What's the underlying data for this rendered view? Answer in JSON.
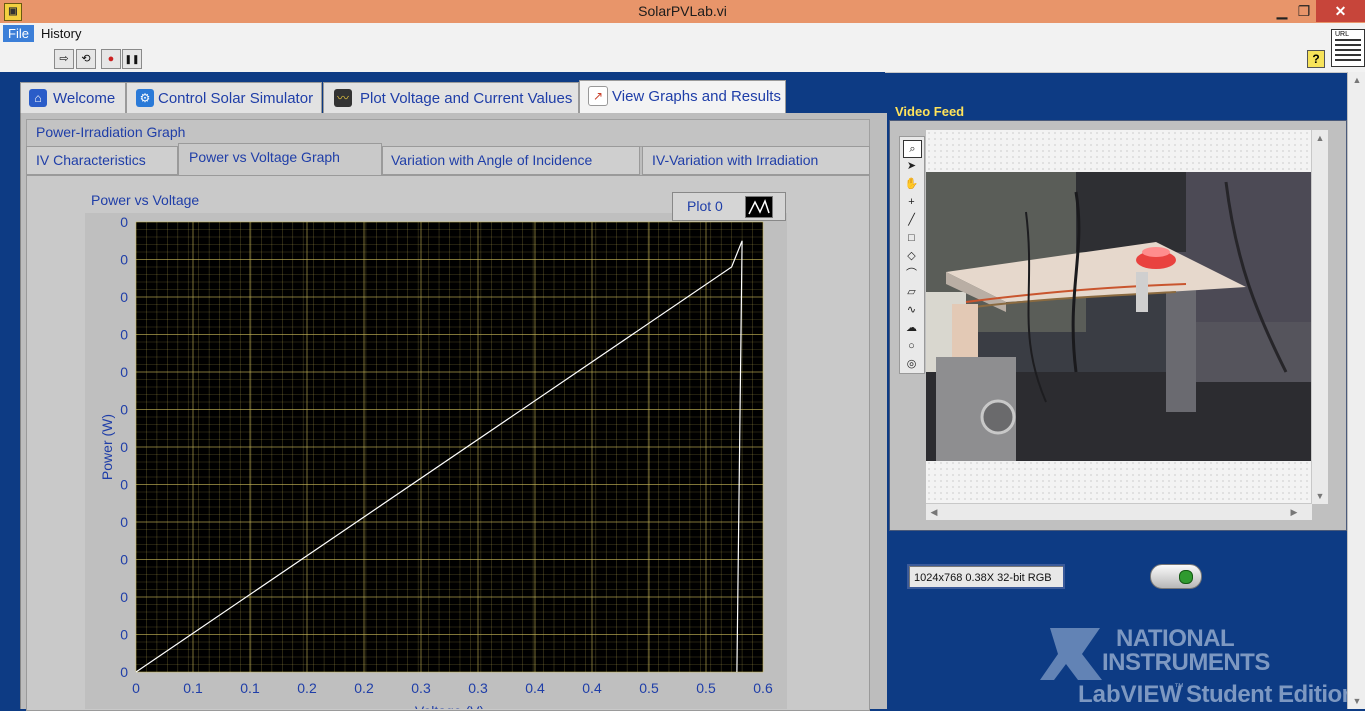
{
  "window": {
    "title": "SolarPVLab.vi",
    "minimize": "▁",
    "restore": "❐",
    "close": "✕",
    "app_icon": "▣"
  },
  "menu": {
    "file": "File",
    "history": "History"
  },
  "toolbar": {
    "run": "⇨",
    "run_continuous": "⟲",
    "abort": "●",
    "pause": "❚❚",
    "help": "?",
    "url": "URL"
  },
  "tabs": [
    {
      "label": "Welcome",
      "icon": "home-icon",
      "glyph": "⌂"
    },
    {
      "label": "Control Solar Simulator",
      "icon": "control-icon",
      "glyph": "⚙"
    },
    {
      "label": "Plot Voltage and Current Values",
      "icon": "chart-icon",
      "glyph": "〰"
    },
    {
      "label": "View Graphs and Results",
      "icon": "graph-icon",
      "glyph": "↗"
    }
  ],
  "subtabs": {
    "row1": [
      "Power-Irradiation Graph"
    ],
    "row2": [
      "IV Characteristics",
      "Power vs Voltage Graph",
      "Variation with Angle of Incidence",
      "IV-Variation with Irradiation"
    ]
  },
  "graph": {
    "title": "Power vs Voltage",
    "legend_label": "Plot 0"
  },
  "chart_data": {
    "type": "line",
    "title": "Power vs Voltage",
    "xlabel": "Voltage (V)",
    "ylabel": "Power (W)",
    "x_ticks": [
      "0",
      "0.1",
      "0.1",
      "0.2",
      "0.2",
      "0.3",
      "0.3",
      "0.4",
      "0.4",
      "0.5",
      "0.5",
      "0.6"
    ],
    "y_ticks": [
      "0",
      "0",
      "0",
      "0",
      "0",
      "0",
      "0",
      "0",
      "0",
      "0",
      "0",
      "0",
      "0"
    ],
    "xlim": [
      0,
      0.6
    ],
    "series": [
      {
        "name": "Plot 0",
        "x": [
          0,
          0.57,
          0.58,
          0.575
        ],
        "y": [
          0,
          0.00108,
          0.00115,
          0
        ],
        "color": "#ffffff"
      }
    ],
    "grid": true,
    "legend": "top-right",
    "plot_bg": "#000000",
    "grid_color": "#c8b85a"
  },
  "video": {
    "label": "Video Feed",
    "info": "1024x768 0.38X 32-bit RGB",
    "tools": [
      "zoom-icon",
      "pointer-icon",
      "pan-icon",
      "crosshair-icon",
      "line-icon",
      "rectangle-icon",
      "rotated-rect-icon",
      "polyline-icon",
      "polygon-icon",
      "freehand-icon",
      "freehand-region-icon",
      "oval-icon",
      "annulus-icon"
    ],
    "tool_glyphs": [
      "⌕",
      "➤",
      "✋",
      "+",
      "╱",
      "□",
      "◇",
      "⌒",
      "▱",
      "∿",
      "☁",
      "○",
      "◎"
    ]
  },
  "logo": {
    "line1": "NATIONAL",
    "line2": "INSTRUMENTS",
    "line3": "LabVIEW",
    "tm": "™",
    "line4": "Student Edition"
  }
}
